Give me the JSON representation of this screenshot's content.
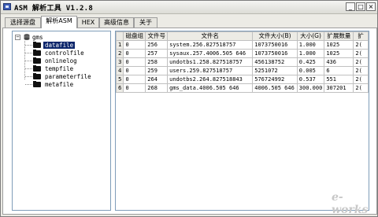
{
  "window": {
    "title": "ASM 解析工具  V1.2.8"
  },
  "titlebar_buttons": [
    "_",
    "□",
    "×"
  ],
  "tabs": [
    {
      "label": "选择源盘"
    },
    {
      "label": "解析ASM",
      "active": true
    },
    {
      "label": "HEX"
    },
    {
      "label": "高级信息"
    },
    {
      "label": "关于"
    }
  ],
  "tree": {
    "root": "gms",
    "children": [
      "datafile",
      "controlfile",
      "onlinelog",
      "tempfile",
      "parameterfile",
      "metafile"
    ],
    "selected": "datafile"
  },
  "table": {
    "columns": [
      "磁盘组",
      "文件号",
      "文件名",
      "文件大小(B)",
      "大小(G)",
      "扩展数量",
      "扩"
    ],
    "rows": [
      {
        "num": "1",
        "cells": [
          "0",
          "256",
          "system.256.827518757",
          "1073750016",
          "1.000",
          "1025",
          "2("
        ]
      },
      {
        "num": "2",
        "cells": [
          "0",
          "257",
          "sysaux.257.4006.505 646",
          "1073750016",
          "1.000",
          "1025",
          "2("
        ]
      },
      {
        "num": "3",
        "cells": [
          "0",
          "258",
          "undotbs1.258.827518757",
          "456138752",
          "0.425",
          "436",
          "2("
        ]
      },
      {
        "num": "4",
        "cells": [
          "0",
          "259",
          "users.259.827518757",
          "5251072",
          "0.005",
          "6",
          "2("
        ]
      },
      {
        "num": "5",
        "cells": [
          "0",
          "264",
          "undotbs2.264.827518843",
          "576724992",
          "0.537",
          "551",
          "2("
        ]
      },
      {
        "num": "6",
        "cells": [
          "0",
          "268",
          "gms_data.4006.505 646",
          "4006.505 646",
          "300.000",
          "307201",
          "2("
        ]
      }
    ]
  },
  "watermark": "e-works"
}
